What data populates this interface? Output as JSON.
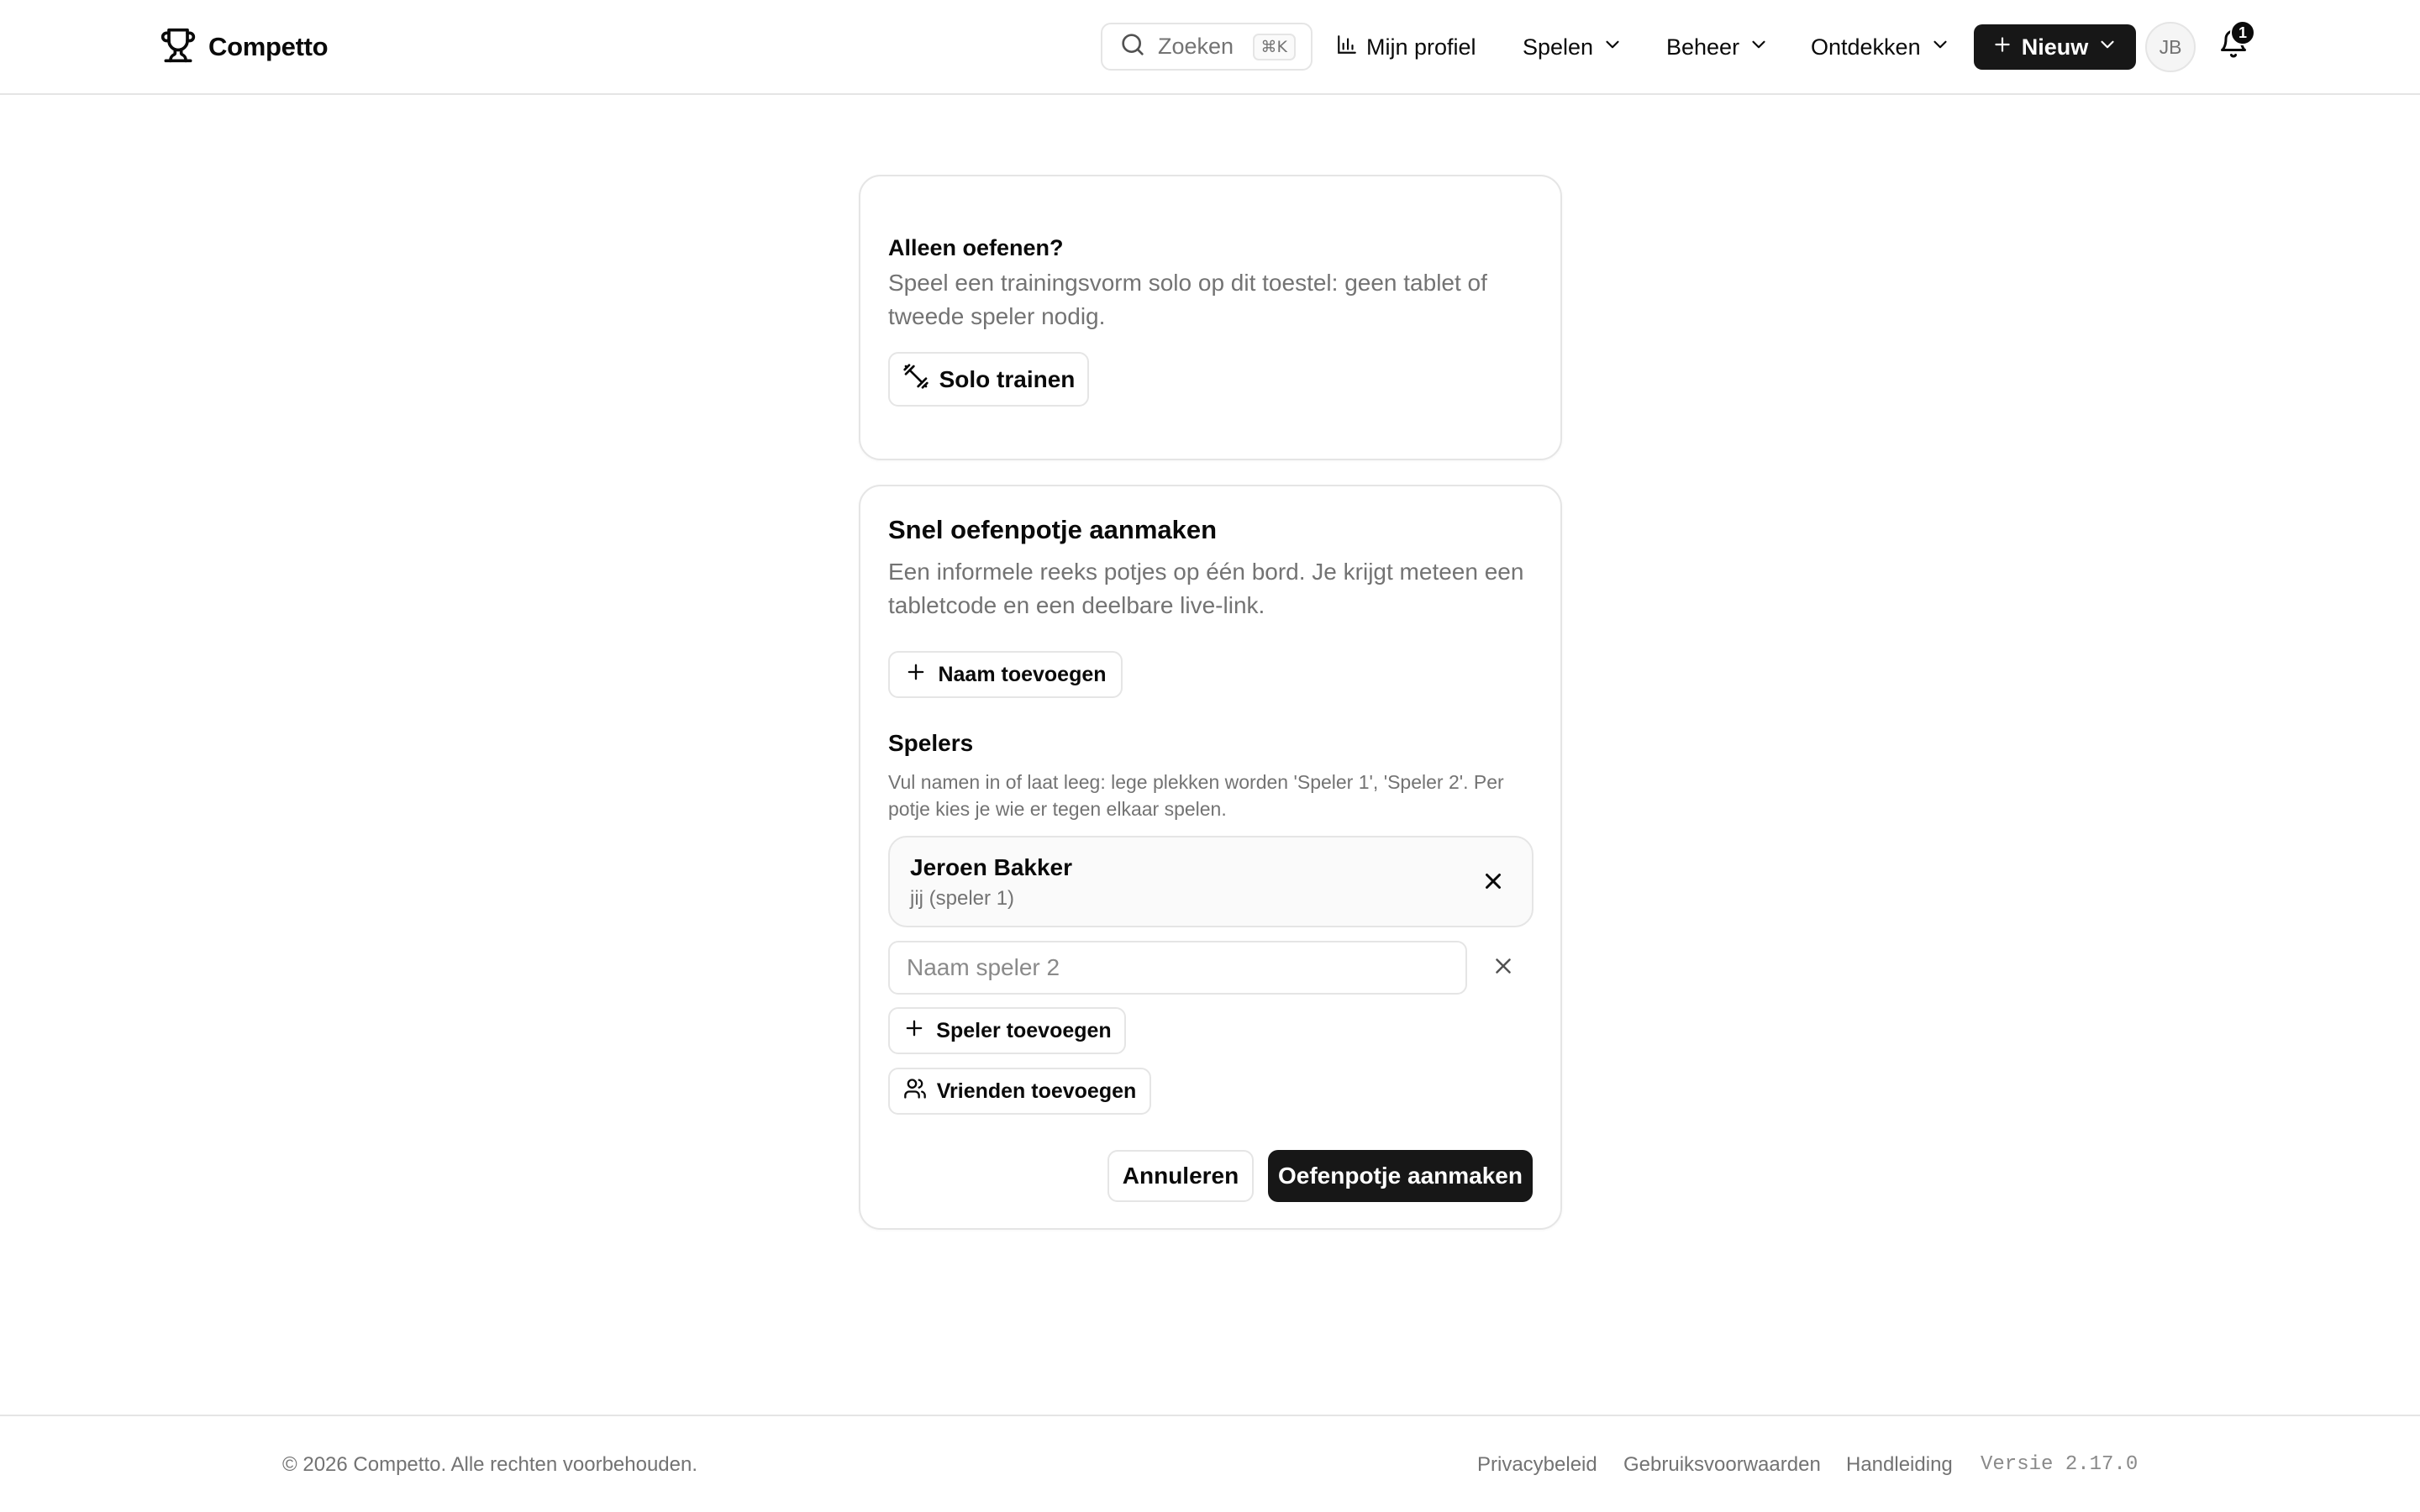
{
  "header": {
    "logo_text": "Competto",
    "search": {
      "placeholder": "Zoeken",
      "shortcut": "⌘K"
    },
    "nav": {
      "profile": "Mijn profiel",
      "spelen": "Spelen",
      "beheer": "Beheer",
      "ontdekken": "Ontdekken"
    },
    "new_button": "Nieuw",
    "avatar_initials": "JB",
    "notification_count": "1"
  },
  "solo_card": {
    "title": "Alleen oefenen?",
    "description": "Speel een trainingsvorm solo op dit toestel: geen tablet of tweede speler nodig.",
    "button_label": "Solo trainen"
  },
  "quick_card": {
    "title": "Snel oefenpotje aanmaken",
    "description": "Een informele reeks potjes op één bord. Je krijgt meteen een tabletcode en een deelbare live-link.",
    "add_name_label": "Naam toevoegen",
    "players": {
      "title": "Spelers",
      "description": "Vul namen in of laat leeg: lege plekken worden 'Speler 1', 'Speler 2'. Per potje kies je wie er tegen elkaar spelen.",
      "player1_name": "Jeroen Bakker",
      "player1_sub": "jij (speler 1)",
      "player2_value": "",
      "player2_placeholder": "Naam speler 2"
    },
    "add_player_label": "Speler toevoegen",
    "add_friends_label": "Vrienden toevoegen",
    "cancel_label": "Annuleren",
    "create_label": "Oefenpotje aanmaken"
  },
  "footer": {
    "copyright": "© 2026 Competto. Alle rechten voorbehouden.",
    "links": [
      "Privacybeleid",
      "Gebruiksvoorwaarden",
      "Handleiding"
    ],
    "version": "Versie 2.17.0"
  },
  "colors": {
    "primary": "#171717",
    "border": "#e5e5e5",
    "muted_text": "#737373"
  }
}
